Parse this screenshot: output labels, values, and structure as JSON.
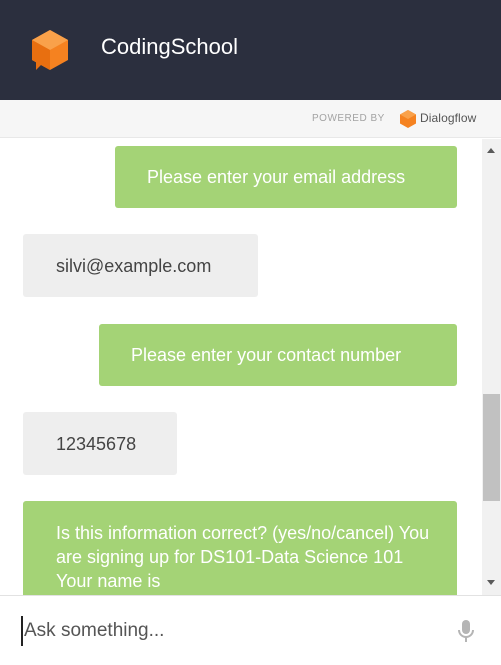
{
  "header": {
    "title": "CodingSchool",
    "logo_icon": "orange-cube-icon"
  },
  "powered": {
    "label": "POWERED BY",
    "brand": "Dialogflow"
  },
  "messages": [
    {
      "role": "bot",
      "text": "Please enter your email address"
    },
    {
      "role": "user",
      "text": "silvi@example.com"
    },
    {
      "role": "bot",
      "text": "Please enter your contact number"
    },
    {
      "role": "user",
      "text": "12345678"
    },
    {
      "role": "bot",
      "text": "Is this information correct? (yes/no/cancel) You are signing up for DS101-Data Science 101 Your name is"
    }
  ],
  "input": {
    "placeholder": "Ask something..."
  },
  "colors": {
    "header_bg": "#2b2f3e",
    "bot_bubble": "#a4d376",
    "user_bubble": "#eeeeee",
    "accent": "#f58220"
  }
}
